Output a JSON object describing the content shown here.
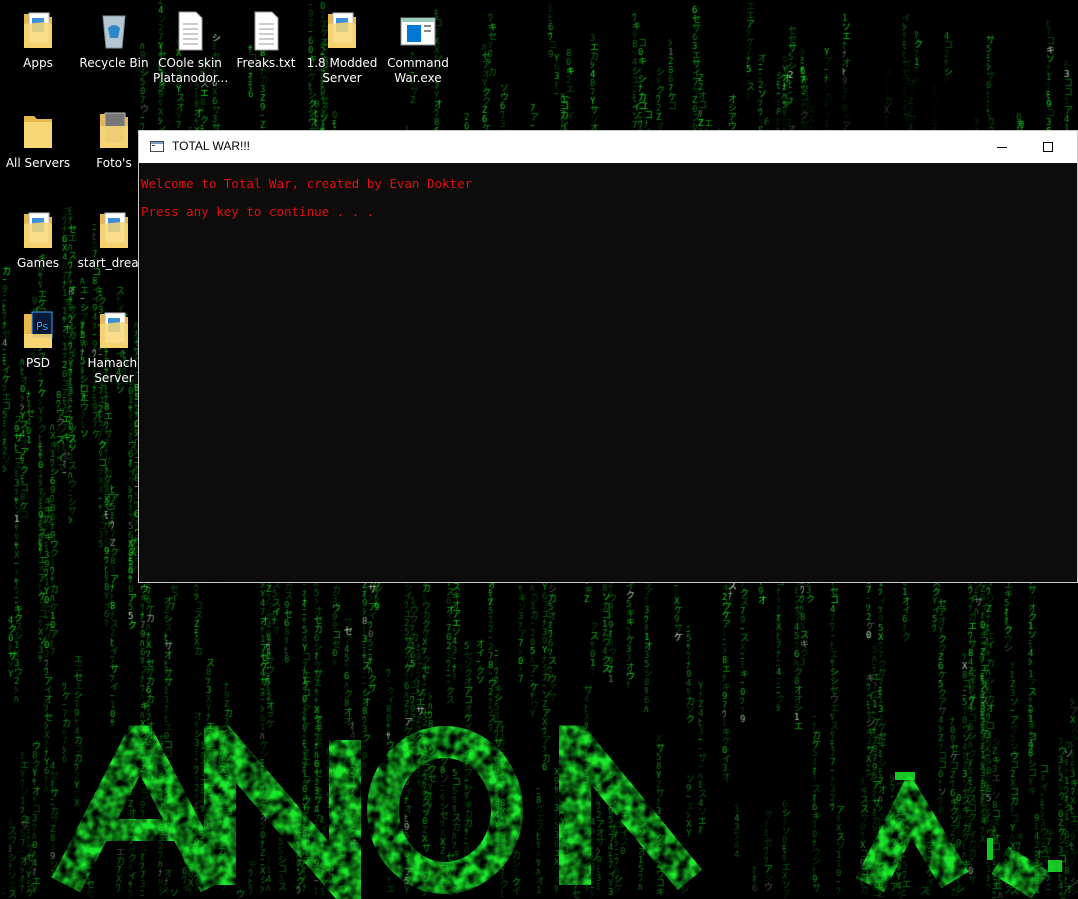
{
  "desktop": {
    "icons": [
      {
        "name": "apps-folder",
        "label": "Apps"
      },
      {
        "name": "recycle-bin",
        "label": "Recycle Bin"
      },
      {
        "name": "coole-skin-file",
        "label": "COole skin Platanodor..."
      },
      {
        "name": "freaks-txt-file",
        "label": "Freaks.txt"
      },
      {
        "name": "modded-server-folder",
        "label": "1.8 Modded Server"
      },
      {
        "name": "command-war-exe",
        "label": "Command War.exe"
      },
      {
        "name": "all-servers-folder",
        "label": "All Servers"
      },
      {
        "name": "fotos-folder",
        "label": "Foto's"
      },
      {
        "name": "games-folder",
        "label": "Games"
      },
      {
        "name": "start-dream-folder",
        "label": "start_dream"
      },
      {
        "name": "psd-folder",
        "label": "PSD"
      },
      {
        "name": "hamachi-server-folder",
        "label": "Hamachi Server"
      }
    ],
    "wallpaper_text": "ANON",
    "accent_color": "#00ff2a"
  },
  "console": {
    "title": "TOTAL WAR!!!",
    "lines": [
      "Welcome to Total War, created by Evan Dokter",
      "Press any key to continue . . ."
    ],
    "text_color": "#e20f0f"
  }
}
